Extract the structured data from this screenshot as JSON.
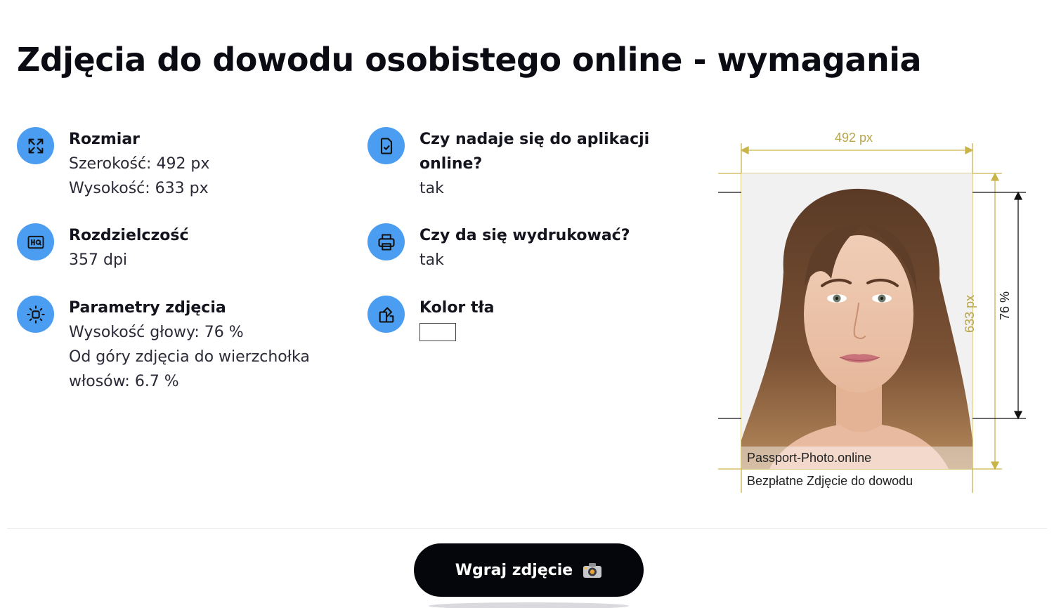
{
  "page": {
    "title": "Zdjęcia do dowodu osobistego online - wymagania"
  },
  "requirements": {
    "size": {
      "icon": "expand-arrows-icon",
      "label": "Rozmiar",
      "width": "Szerokość: 492 px",
      "height": "Wysokość: 633 px"
    },
    "resolution": {
      "icon": "hq-icon",
      "label": "Rozdzielczość",
      "value": "357 dpi"
    },
    "parameters": {
      "icon": "focus-icon",
      "label": "Parametry zdjęcia",
      "head_height": "Wysokość głowy: 76 %",
      "top_line1": "Od góry zdjęcia do wierzchołka",
      "top_line2": "włosów: 6.7 %"
    },
    "online": {
      "icon": "document-check-icon",
      "label_line1": "Czy nadaje się do aplikacji",
      "label_line2": "online?",
      "value": "tak"
    },
    "printable": {
      "icon": "printer-icon",
      "label": "Czy da się wydrukować?",
      "value": "tak"
    },
    "background": {
      "icon": "palette-icon",
      "label": "Kolor tła",
      "swatch_color": "#ffffff"
    }
  },
  "preview": {
    "width_label": "492 px",
    "height_label": "633 px",
    "head_label": "76 %",
    "watermark": "Passport-Photo.online",
    "caption": "Bezpłatne Zdjęcie do dowodu",
    "guide_color": "#c9b44a"
  },
  "upload": {
    "label": "Wgraj zdjęcie",
    "icon": "camera-icon"
  },
  "colors": {
    "accent": "#4a9df0",
    "button": "#05060c"
  }
}
